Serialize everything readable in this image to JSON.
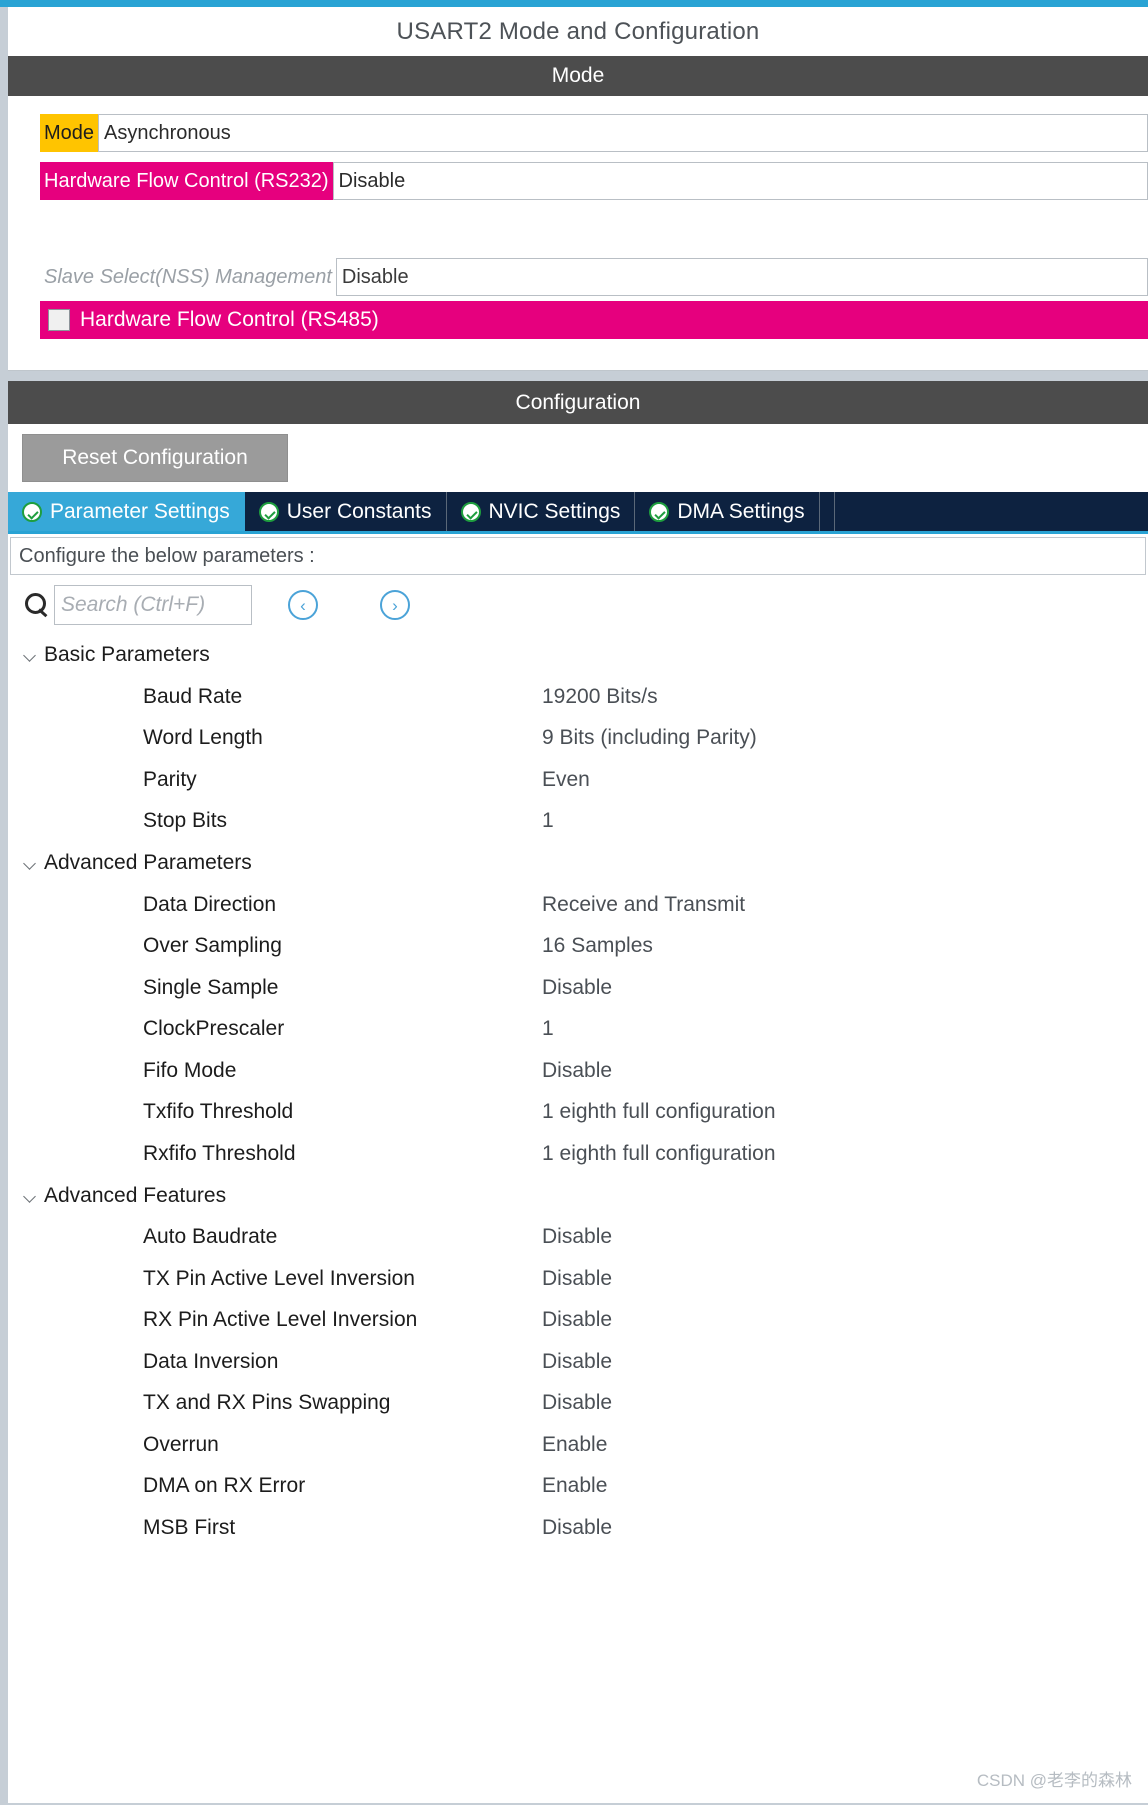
{
  "panel": {
    "title": "USART2 Mode and Configuration"
  },
  "mode_section": {
    "header": "Mode",
    "rows": [
      {
        "label": "Mode",
        "value": "Asynchronous",
        "label_style": "yellow"
      },
      {
        "label": "Hardware Flow Control (RS232)",
        "value": "Disable",
        "label_style": "magenta"
      },
      {
        "label": "Hardware Flow Control (RS485)",
        "value": "",
        "label_style": "magenta-checkbox",
        "checked": false
      },
      {
        "label": "Slave Select(NSS) Management",
        "value": "Disable",
        "label_style": "gray-italic"
      }
    ]
  },
  "configuration_section": {
    "header": "Configuration",
    "reset_button": "Reset Configuration",
    "tabs": [
      {
        "label": "Parameter Settings",
        "active": true,
        "icon": "check-circle-icon"
      },
      {
        "label": "User Constants",
        "active": false,
        "icon": "check-circle-icon"
      },
      {
        "label": "NVIC Settings",
        "active": false,
        "icon": "check-circle-icon"
      },
      {
        "label": "DMA Settings",
        "active": false,
        "icon": "check-circle-icon"
      }
    ],
    "hint": "Configure the below parameters :",
    "search": {
      "placeholder": "Search (Ctrl+F)",
      "value": "",
      "icon": "search-icon",
      "prev_icon": "chevron-left-circle-icon",
      "next_icon": "chevron-right-circle-icon",
      "prev_glyph": "‹",
      "next_glyph": "›"
    },
    "groups": [
      {
        "name": "Basic Parameters",
        "expanded": true,
        "rows": [
          {
            "name": "Baud Rate",
            "value": "19200 Bits/s"
          },
          {
            "name": "Word Length",
            "value": "9 Bits (including Parity)"
          },
          {
            "name": "Parity",
            "value": "Even"
          },
          {
            "name": "Stop Bits",
            "value": "1"
          }
        ]
      },
      {
        "name": "Advanced Parameters",
        "expanded": true,
        "rows": [
          {
            "name": "Data Direction",
            "value": "Receive and Transmit"
          },
          {
            "name": "Over Sampling",
            "value": "16 Samples"
          },
          {
            "name": "Single Sample",
            "value": "Disable"
          },
          {
            "name": "ClockPrescaler",
            "value": "1"
          },
          {
            "name": "Fifo Mode",
            "value": "Disable"
          },
          {
            "name": "Txfifo Threshold",
            "value": "1 eighth full configuration"
          },
          {
            "name": "Rxfifo Threshold",
            "value": "1 eighth full configuration"
          }
        ]
      },
      {
        "name": "Advanced Features",
        "expanded": true,
        "rows": [
          {
            "name": "Auto Baudrate",
            "value": "Disable"
          },
          {
            "name": "TX Pin Active Level Inversion",
            "value": "Disable"
          },
          {
            "name": "RX Pin Active Level Inversion",
            "value": "Disable"
          },
          {
            "name": "Data Inversion",
            "value": "Disable"
          },
          {
            "name": "TX and RX Pins Swapping",
            "value": "Disable"
          },
          {
            "name": "Overrun",
            "value": "Enable"
          },
          {
            "name": "DMA on RX Error",
            "value": "Enable"
          },
          {
            "name": "MSB First",
            "value": "Disable"
          }
        ]
      }
    ]
  },
  "watermark": "CSDN @老李的森林",
  "colors": {
    "accent_blue": "#29a3d4",
    "tab_active": "#36a8d8",
    "tab_inactive": "#0d2240",
    "header_dark": "#4c4c4c",
    "magenta": "#e6007e",
    "yellow": "#ffc400",
    "rail": "#c6ced6"
  }
}
